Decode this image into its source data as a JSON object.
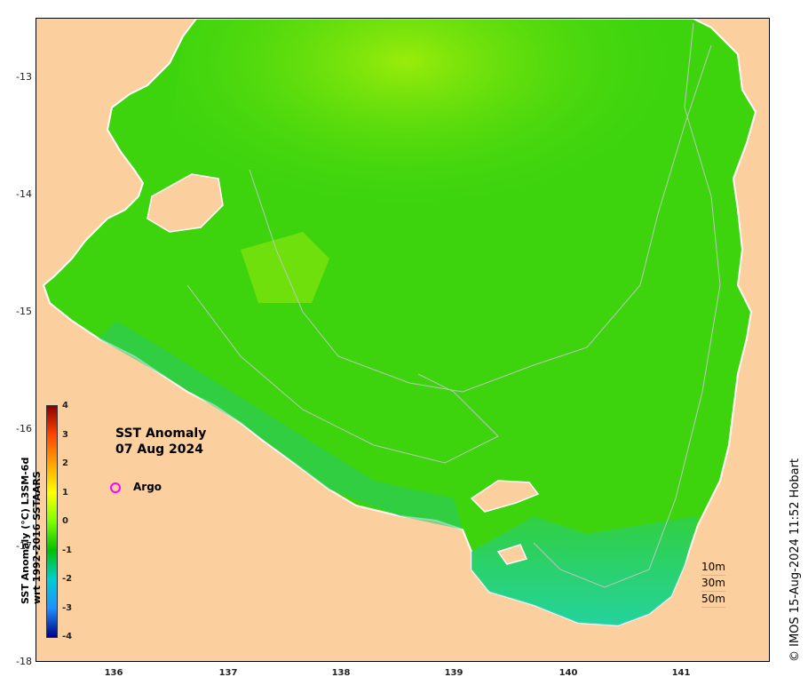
{
  "map": {
    "title": "SST Anomaly",
    "date": "07 Aug 2024",
    "lat_range": [
      -18,
      -12.5
    ],
    "lon_range": [
      135.3,
      141.8
    ],
    "y_ticks": [
      "-13",
      "-14",
      "-15",
      "-16",
      "-17",
      "-18"
    ],
    "x_ticks": [
      "136",
      "137",
      "138",
      "139",
      "140",
      "141"
    ]
  },
  "legend": {
    "argo_label": "Argo",
    "argo_color": "#ff00ff"
  },
  "colorbar": {
    "label_line1": "SST Anomaly (°C) L3SM-6d",
    "label_line2": "wrt 1992-2016 SSTAARS",
    "ticks": [
      "4",
      "3",
      "2",
      "1",
      "0",
      "-1",
      "-2",
      "-3",
      "-4"
    ],
    "colors": [
      "#8b0000",
      "#ff4500",
      "#ffa500",
      "#ffff00",
      "#7fff00",
      "#00c000",
      "#00ced1",
      "#1e90ff",
      "#00008b"
    ]
  },
  "depth_legend": [
    "10m",
    "30m",
    "50m"
  ],
  "credit": "© IMOS 15-Aug-2024 11:52 Hobart",
  "colors": {
    "land": "#fccf9f",
    "sea_base": "#3dd40e",
    "sea_bright": "#8ee80c",
    "sea_cool": "#18c46e",
    "sea_cyan": "#1fd3c2"
  }
}
